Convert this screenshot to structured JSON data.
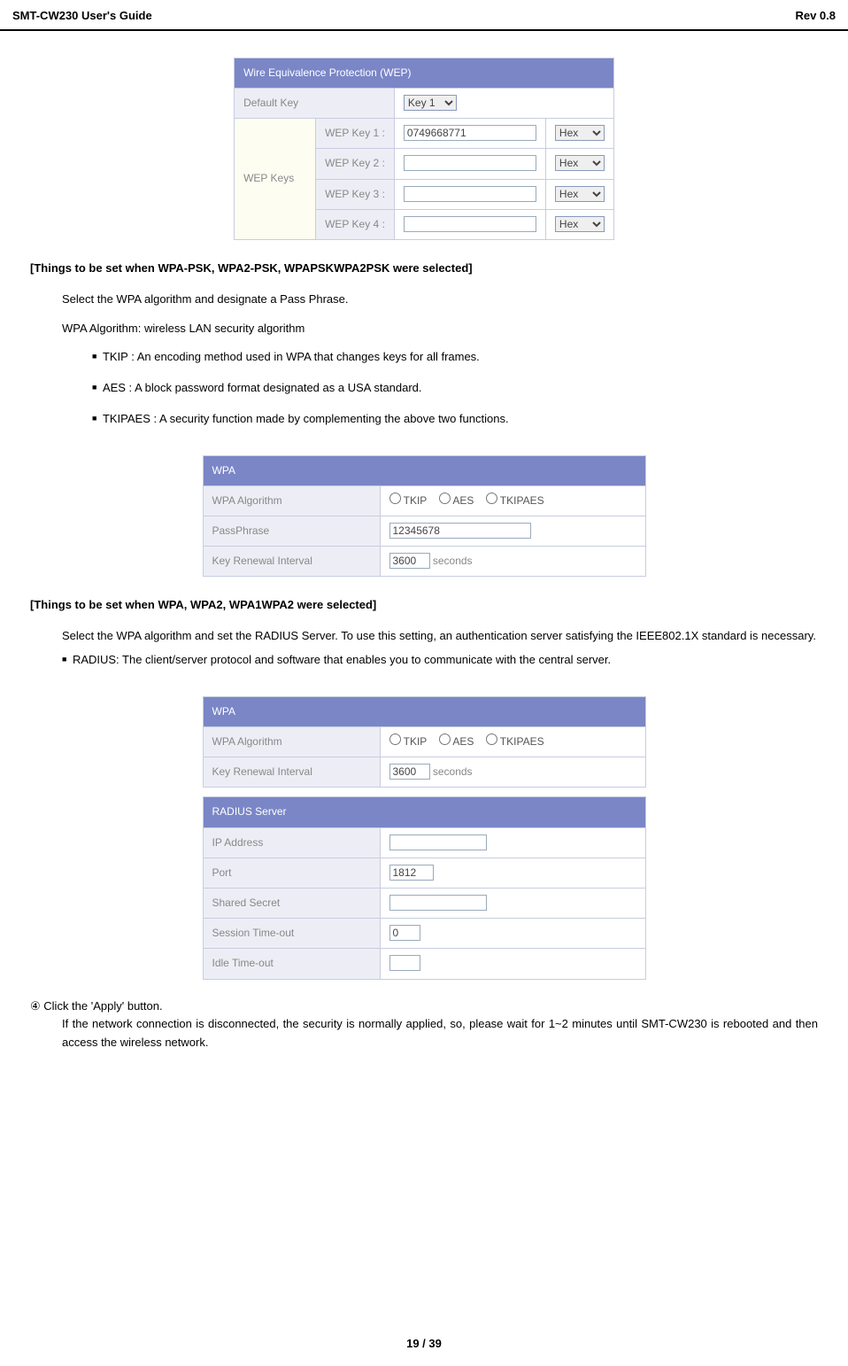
{
  "header": {
    "left": "SMT-CW230 User's Guide",
    "right": "Rev 0.8"
  },
  "wep": {
    "title": "Wire Equivalence Protection (WEP)",
    "defaultKeyLabel": "Default Key",
    "defaultKeySelected": "Key 1",
    "wepKeysLabel": "WEP Keys",
    "rows": [
      {
        "label": "WEP Key 1 :",
        "value": "0749668771",
        "fmt": "Hex"
      },
      {
        "label": "WEP Key 2 :",
        "value": "",
        "fmt": "Hex"
      },
      {
        "label": "WEP Key 3 :",
        "value": "",
        "fmt": "Hex"
      },
      {
        "label": "WEP Key 4 :",
        "value": "",
        "fmt": "Hex"
      }
    ]
  },
  "section_psk": {
    "heading": "[Things to be set when WPA-PSK, WPA2-PSK, WPAPSKWPA2PSK were selected]",
    "line1": "Select the WPA algorithm and designate a Pass Phrase.",
    "line2": "WPA Algorithm: wireless LAN security algorithm",
    "b1": "TKIP : An encoding method used in WPA that changes keys for all frames.",
    "b2": "AES : A block password format designated as a USA standard.",
    "b3": "TKIPAES : A security function made by complementing the above two functions."
  },
  "wpa1": {
    "title": "WPA",
    "algLabel": "WPA Algorithm",
    "algOptions": [
      "TKIP",
      "AES",
      "TKIPAES"
    ],
    "passLabel": "PassPhrase",
    "passValue": "12345678",
    "keyRenewLabel": "Key Renewal Interval",
    "keyRenewValue": "3600",
    "keyRenewUnit": "seconds"
  },
  "section_wpa": {
    "heading": "[Things to be set when WPA, WPA2, WPA1WPA2 were selected]",
    "line1": "Select the WPA algorithm and set the RADIUS Server. To use this setting, an authentication server satisfying the IEEE802.1X standard is necessary.",
    "b1": "RADIUS: The client/server protocol and software that enables you to communicate with the central server."
  },
  "wpa2": {
    "title": "WPA",
    "algLabel": "WPA Algorithm",
    "algOptions": [
      "TKIP",
      "AES",
      "TKIPAES"
    ],
    "keyRenewLabel": "Key Renewal Interval",
    "keyRenewValue": "3600",
    "keyRenewUnit": "seconds"
  },
  "radius": {
    "title": "RADIUS Server",
    "ipLabel": "IP Address",
    "ipValue": "",
    "portLabel": "Port",
    "portValue": "1812",
    "secretLabel": "Shared Secret",
    "secretValue": "",
    "sessLabel": "Session Time-out",
    "sessValue": "0",
    "idleLabel": "Idle Time-out",
    "idleValue": ""
  },
  "step4": {
    "line1": "Click the  'Apply'  button.",
    "line2": "If the network connection is disconnected, the security is normally applied, so, please wait for 1~2 minutes until SMT-CW230 is rebooted and then access the wireless network."
  },
  "footer": {
    "pageNum": "19 / 39"
  }
}
